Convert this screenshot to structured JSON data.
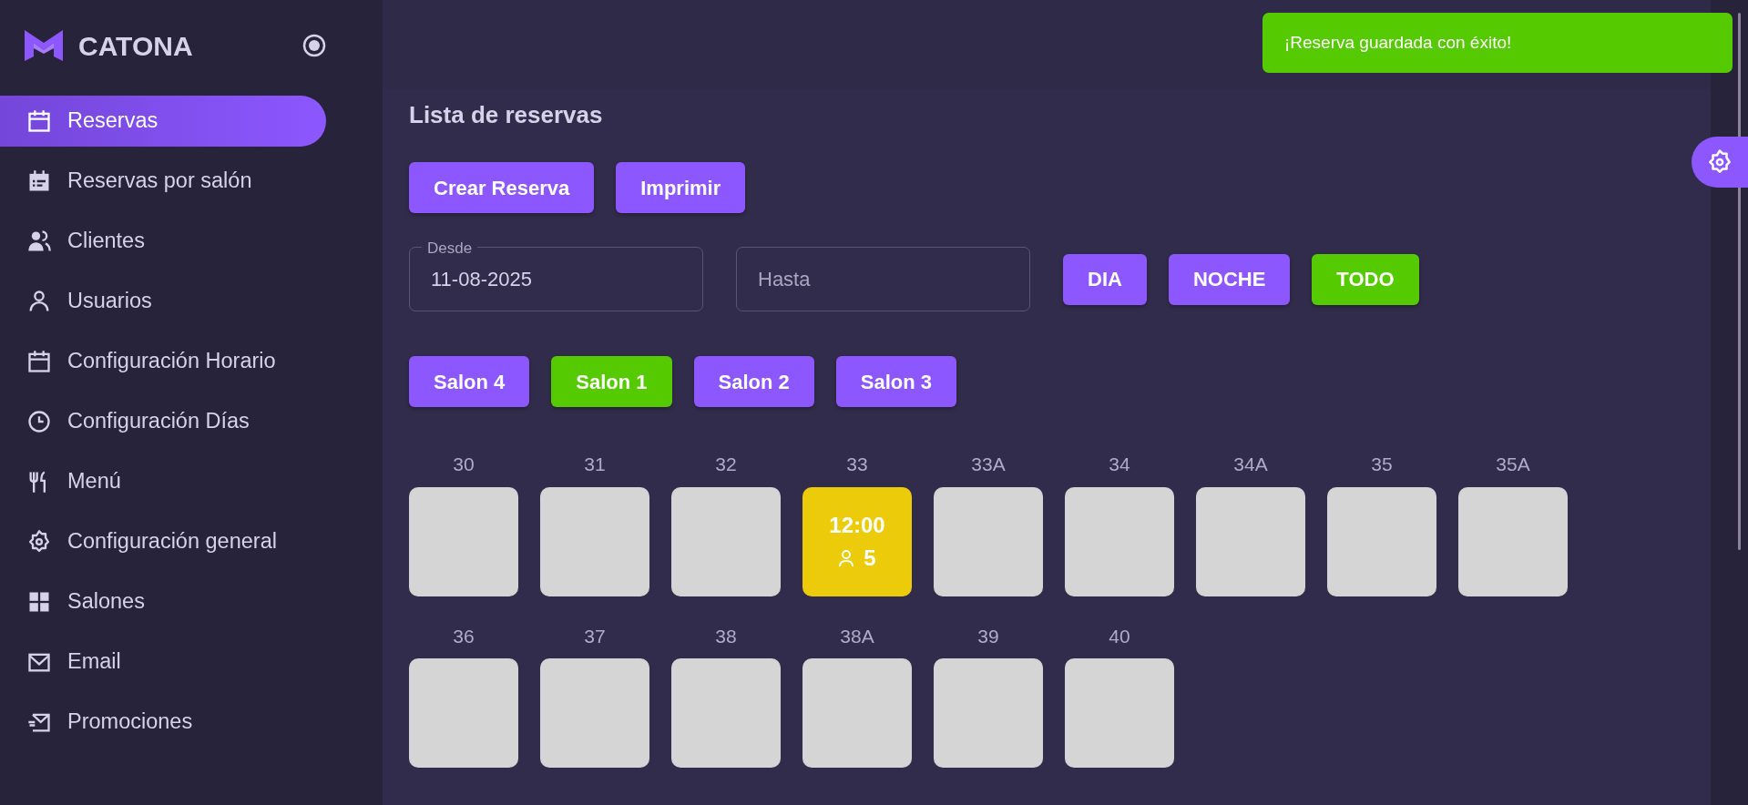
{
  "brand": {
    "name": "CATONA"
  },
  "sidebar": {
    "items": [
      {
        "label": "Reservas",
        "selected": true
      },
      {
        "label": "Reservas por salón",
        "selected": false
      },
      {
        "label": "Clientes",
        "selected": false
      },
      {
        "label": "Usuarios",
        "selected": false
      },
      {
        "label": "Configuración Horario",
        "selected": false
      },
      {
        "label": "Configuración Días",
        "selected": false
      },
      {
        "label": "Menú",
        "selected": false
      },
      {
        "label": "Configuración general",
        "selected": false
      },
      {
        "label": "Salones",
        "selected": false
      },
      {
        "label": "Email",
        "selected": false
      },
      {
        "label": "Promociones",
        "selected": false
      }
    ]
  },
  "toast": {
    "message": "¡Reserva guardada con éxito!"
  },
  "page": {
    "title": "Lista de reservas",
    "actions": [
      "Crear Reserva",
      "Imprimir"
    ],
    "date_from": {
      "label": "Desde",
      "value": "11-08-2025"
    },
    "date_to": {
      "placeholder": "Hasta"
    },
    "shifts": [
      {
        "label": "DIA",
        "selected": false
      },
      {
        "label": "NOCHE",
        "selected": false
      },
      {
        "label": "TODO",
        "selected": true
      }
    ],
    "rooms": [
      {
        "label": "Salon 4",
        "selected": false
      },
      {
        "label": "Salon 1",
        "selected": true
      },
      {
        "label": "Salon 2",
        "selected": false
      },
      {
        "label": "Salon 3",
        "selected": false
      }
    ],
    "table_rows": [
      {
        "tables": [
          {
            "number": "30",
            "booked": false
          },
          {
            "number": "31",
            "booked": false
          },
          {
            "number": "32",
            "booked": false
          },
          {
            "number": "33",
            "booked": true,
            "time": "12:00",
            "guests": "5"
          },
          {
            "number": "33A",
            "booked": false
          },
          {
            "number": "34",
            "booked": false
          },
          {
            "number": "34A",
            "booked": false
          },
          {
            "number": "35",
            "booked": false
          },
          {
            "number": "35A",
            "booked": false
          }
        ]
      },
      {
        "tables": [
          {
            "number": "36",
            "booked": false
          },
          {
            "number": "37",
            "booked": false
          },
          {
            "number": "38",
            "booked": false
          },
          {
            "number": "38A",
            "booked": false
          },
          {
            "number": "39",
            "booked": false
          },
          {
            "number": "40",
            "booked": false
          }
        ]
      }
    ]
  }
}
